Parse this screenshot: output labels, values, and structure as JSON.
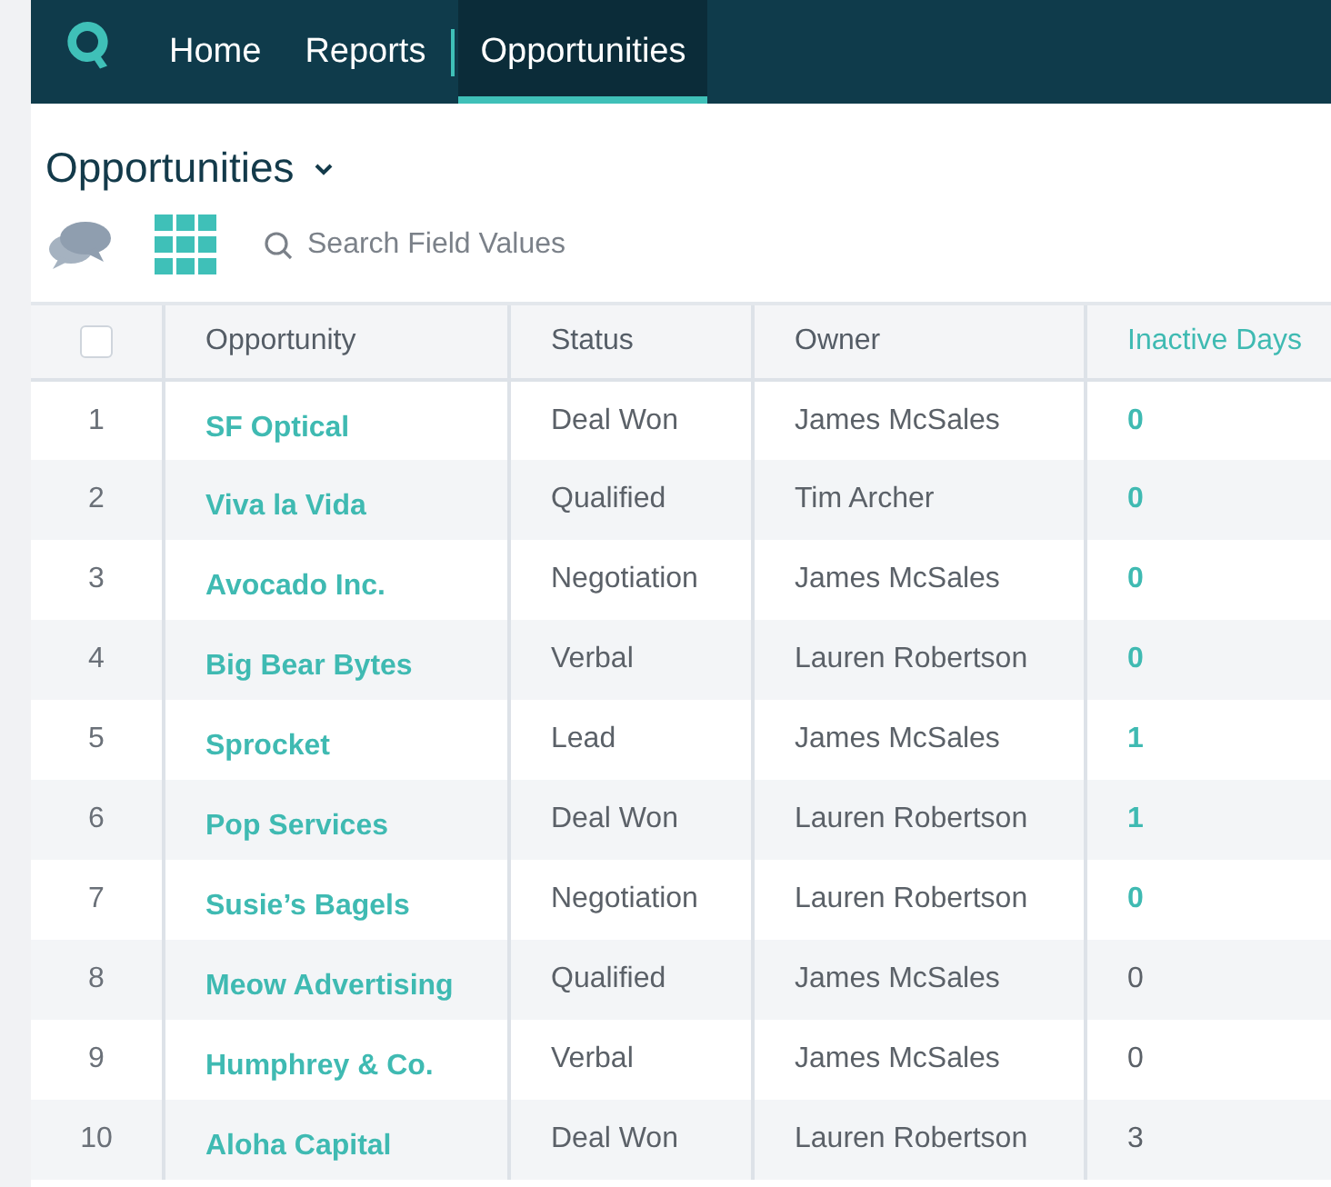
{
  "nav": {
    "items": [
      {
        "label": "Home",
        "selected": false
      },
      {
        "label": "Reports",
        "selected": false
      },
      {
        "label": "Opportunities",
        "selected": true
      }
    ]
  },
  "page": {
    "title": "Opportunities",
    "search": {
      "placeholder": "Search Field Values"
    }
  },
  "table": {
    "select_all_checked": false,
    "columns": [
      "Opportunity",
      "Status",
      "Owner",
      "Inactive Days"
    ],
    "rows": [
      {
        "number": "1",
        "opportunity": "SF Optical",
        "status": "Deal Won",
        "owner": "James McSales",
        "inactive_days": "0",
        "inactive_linked": true
      },
      {
        "number": "2",
        "opportunity": "Viva la Vida",
        "status": "Qualified",
        "owner": "Tim Archer",
        "inactive_days": "0",
        "inactive_linked": true
      },
      {
        "number": "3",
        "opportunity": "Avocado Inc.",
        "status": "Negotiation",
        "owner": "James McSales",
        "inactive_days": "0",
        "inactive_linked": true
      },
      {
        "number": "4",
        "opportunity": "Big Bear Bytes",
        "status": "Verbal",
        "owner": "Lauren Robertson",
        "inactive_days": "0",
        "inactive_linked": true
      },
      {
        "number": "5",
        "opportunity": "Sprocket",
        "status": "Lead",
        "owner": "James McSales",
        "inactive_days": "1",
        "inactive_linked": true
      },
      {
        "number": "6",
        "opportunity": "Pop Services",
        "status": "Deal Won",
        "owner": "Lauren Robertson",
        "inactive_days": "1",
        "inactive_linked": true
      },
      {
        "number": "7",
        "opportunity": "Susie’s Bagels",
        "status": "Negotiation",
        "owner": "Lauren Robertson",
        "inactive_days": "0",
        "inactive_linked": true
      },
      {
        "number": "8",
        "opportunity": "Meow Advertising",
        "status": "Qualified",
        "owner": "James McSales",
        "inactive_days": "0",
        "inactive_linked": false
      },
      {
        "number": "9",
        "opportunity": "Humphrey & Co.",
        "status": "Verbal",
        "owner": "James McSales",
        "inactive_days": "0",
        "inactive_linked": false
      },
      {
        "number": "10",
        "opportunity": "Aloha Capital",
        "status": "Deal Won",
        "owner": "Lauren Robertson",
        "inactive_days": "3",
        "inactive_linked": false
      }
    ]
  }
}
